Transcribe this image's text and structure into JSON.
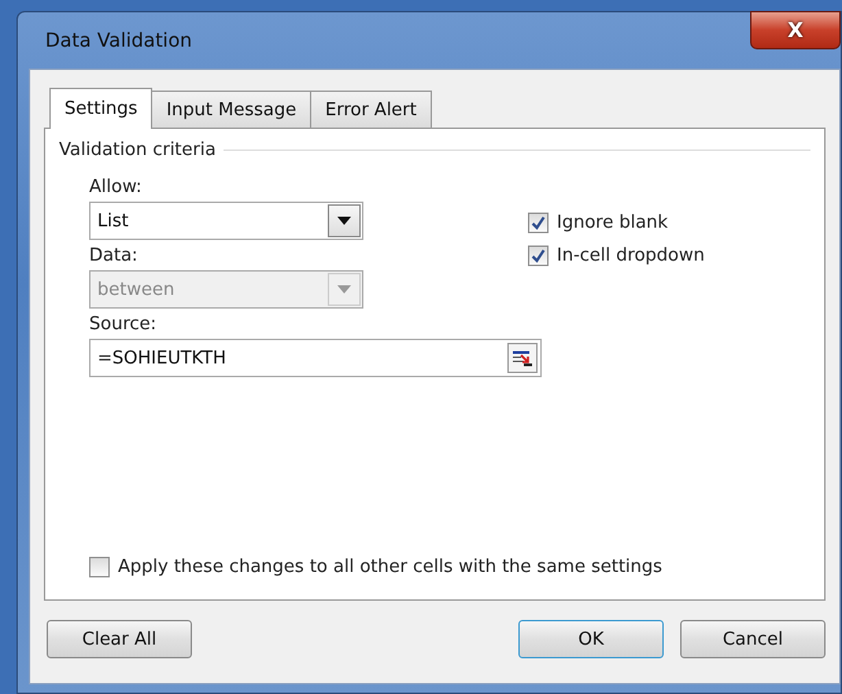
{
  "window": {
    "title": "Data Validation",
    "close": "X"
  },
  "tabs": [
    {
      "label": "Settings",
      "selected": true
    },
    {
      "label": "Input Message",
      "selected": false
    },
    {
      "label": "Error Alert",
      "selected": false
    }
  ],
  "group": {
    "title": "Validation criteria"
  },
  "allow": {
    "label": "Allow:",
    "value": "List",
    "disabled": false
  },
  "data": {
    "label": "Data:",
    "value": "between",
    "disabled": true
  },
  "source": {
    "label": "Source:",
    "value": "=SOHIEUTKTH"
  },
  "options": [
    {
      "label": "Ignore blank",
      "checked": true
    },
    {
      "label": "In-cell dropdown",
      "checked": true
    }
  ],
  "apply": {
    "label": "Apply these changes to all other cells with the same settings",
    "checked": false
  },
  "buttons": [
    {
      "label": "Clear All",
      "kind": "left",
      "default": false
    },
    {
      "label": "OK",
      "kind": "right",
      "default": true
    },
    {
      "label": "Cancel",
      "kind": "right",
      "default": false
    }
  ]
}
